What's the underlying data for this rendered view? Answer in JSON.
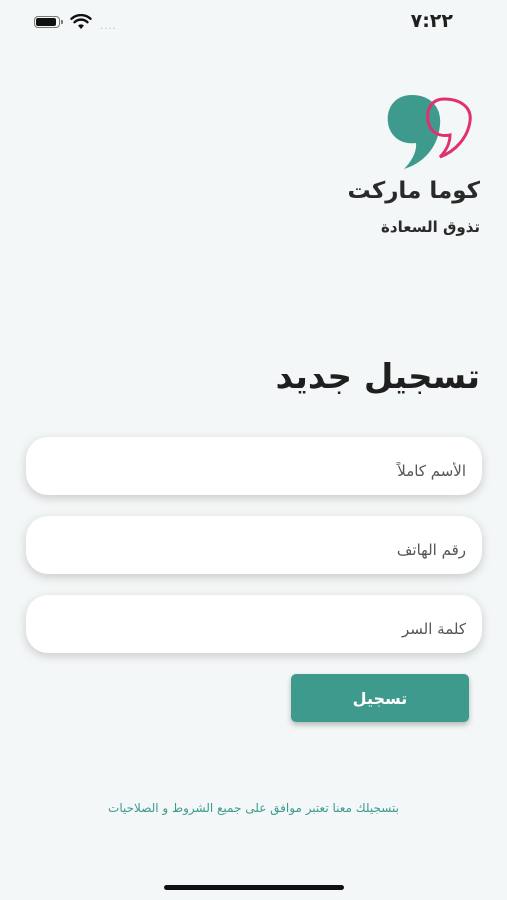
{
  "status_bar": {
    "time": "٧:٢٢",
    "signal": "...."
  },
  "brand": {
    "name": "كوما ماركت",
    "tagline": "تذوق السعادة",
    "colors": {
      "teal": "#3d9a8d",
      "pink": "#e0316e"
    }
  },
  "form": {
    "title": "تسجيل جديد",
    "full_name": {
      "placeholder": "الأسم كاملاً",
      "value": ""
    },
    "phone": {
      "placeholder": "رقم الهاتف",
      "value": ""
    },
    "password": {
      "placeholder": "كلمة السر",
      "value": ""
    },
    "submit_label": "تسجيل"
  },
  "terms_text": "بتسجيلك معنا تعتبر موافق على جميع الشروط و الصلاحيات",
  "icons": {
    "battery": "battery-icon",
    "wifi": "wifi-icon",
    "logo": "quote-logo-icon"
  }
}
